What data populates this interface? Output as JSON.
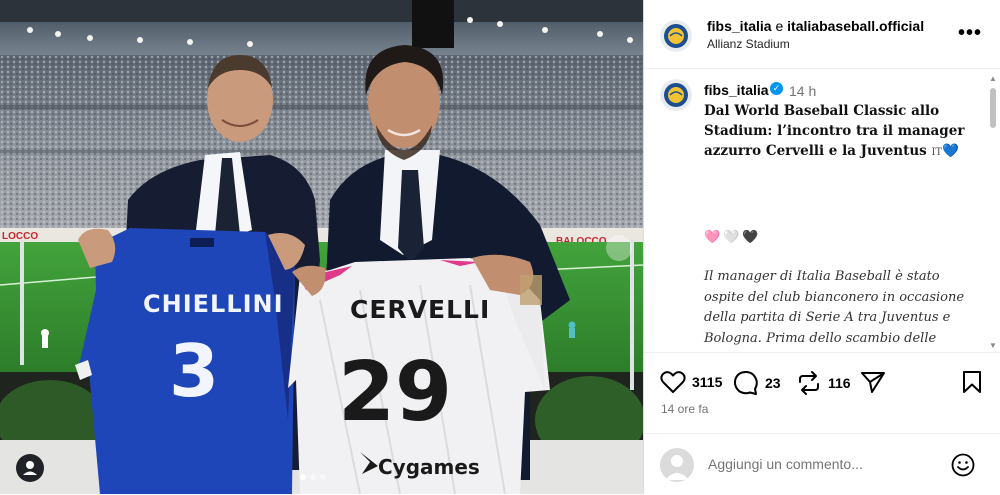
{
  "header": {
    "account1": "fibs_italia",
    "separator": "e",
    "account2": "italiabaseball.official",
    "location": "Allianz Stadium",
    "more_label": "•••"
  },
  "caption": {
    "username": "fibs_italia",
    "time": "14 h",
    "title": "Dal World Baseball Classic allo Stadium: l’incontro tra il manager azzurro Cervelli e la Juventus",
    "flag": "IT",
    "title_emoji": "💙",
    "hearts": "🩷🤍🖤",
    "body": "Il manager di Italia Baseball è stato ospite del club bianconero in occasione della partita di Serie A tra Juventus e Bologna. Prima dello scambio delle maglie con Chiellini, si è intrattenuto con Comolli, Spalletti e Vlahovic"
  },
  "actions": {
    "likes": "3115",
    "comments": "23",
    "reposts": "116"
  },
  "timestamp": "14 ore fa",
  "comment_input": {
    "placeholder": "Aggiungi un commento..."
  },
  "photo": {
    "jersey_left_name": "CHIELLINI",
    "jersey_left_number": "3",
    "jersey_right_name": "CERVELLI",
    "jersey_right_number": "29",
    "sponsor": "Cygames",
    "ad_left": "LOCCO",
    "ad_right": "BALOCCO"
  },
  "colors": {
    "accent": "#0095f6",
    "jersey_blue": "#1a3fb0",
    "muted": "#737373"
  }
}
